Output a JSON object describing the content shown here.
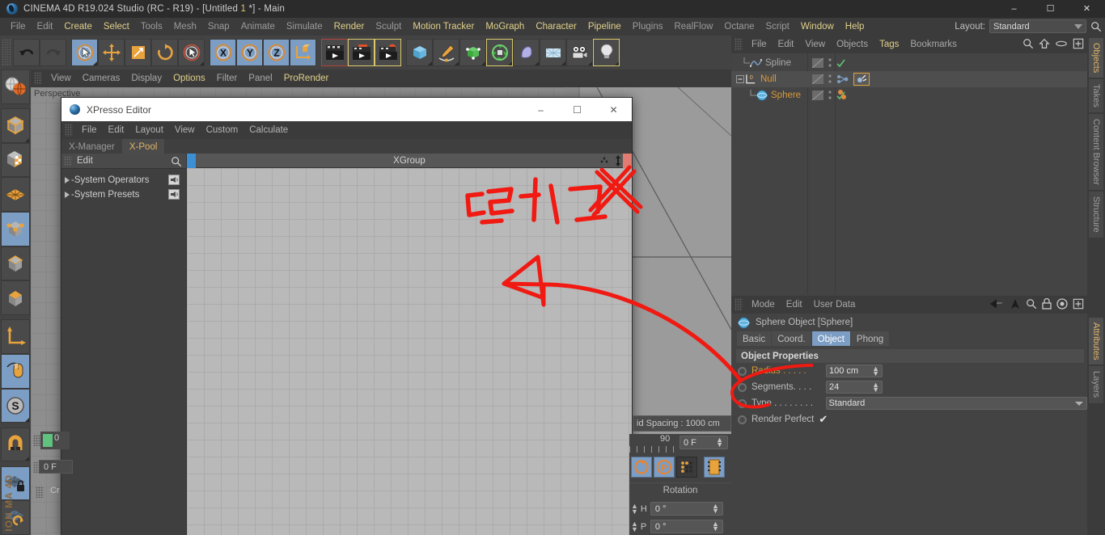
{
  "window": {
    "title_prefix": "CINEMA 4D R19.024 Studio (RC - R19) - [Untitled ",
    "title_num": "1",
    "title_suffix": " *] - Main",
    "minimize": "–",
    "maximize": "☐",
    "close": "✕"
  },
  "menubar": {
    "items": [
      {
        "label": "File",
        "style": "dim"
      },
      {
        "label": "Edit",
        "style": "dim"
      },
      {
        "label": "Create",
        "style": "hl"
      },
      {
        "label": "Select",
        "style": "hl"
      },
      {
        "label": "Tools",
        "style": "dim"
      },
      {
        "label": "Mesh",
        "style": "dim"
      },
      {
        "label": "Snap",
        "style": "dim"
      },
      {
        "label": "Animate",
        "style": "dim"
      },
      {
        "label": "Simulate",
        "style": "dim"
      },
      {
        "label": "Render",
        "style": "hl"
      },
      {
        "label": "Sculpt",
        "style": "dim"
      },
      {
        "label": "Motion Tracker",
        "style": "hl"
      },
      {
        "label": "MoGraph",
        "style": "hl"
      },
      {
        "label": "Character",
        "style": "hl"
      },
      {
        "label": "Pipeline",
        "style": "hl"
      },
      {
        "label": "Plugins",
        "style": "dim"
      },
      {
        "label": "RealFlow",
        "style": "dim"
      },
      {
        "label": "Octane",
        "style": "dim"
      },
      {
        "label": "Script",
        "style": "dim"
      },
      {
        "label": "Window",
        "style": "hl"
      },
      {
        "label": "Help",
        "style": "hl"
      }
    ],
    "layout_label": "Layout:",
    "layout_value": "Standard"
  },
  "viewport": {
    "menus": [
      {
        "label": "View",
        "style": "dim"
      },
      {
        "label": "Cameras",
        "style": "dim"
      },
      {
        "label": "Display",
        "style": "dim"
      },
      {
        "label": "Options",
        "style": "hl"
      },
      {
        "label": "Filter",
        "style": "dim"
      },
      {
        "label": "Panel",
        "style": "dim"
      },
      {
        "label": "ProRender",
        "style": "hl"
      }
    ],
    "label": "Perspective"
  },
  "xpresso": {
    "title": "XPresso Editor",
    "minimize": "–",
    "maximize": "☐",
    "close": "✕",
    "menus": [
      "File",
      "Edit",
      "Layout",
      "View",
      "Custom",
      "Calculate"
    ],
    "tabs": [
      {
        "label": "X-Manager",
        "active": false
      },
      {
        "label": "X-Pool",
        "active": true
      }
    ],
    "pool": {
      "edit_label": "Edit",
      "items": [
        {
          "label": "-System Operators"
        },
        {
          "label": "-System Presets"
        }
      ]
    },
    "graph_title": "XGroup"
  },
  "object_manager": {
    "menus": [
      {
        "label": "File",
        "style": "dim"
      },
      {
        "label": "Edit",
        "style": "dim"
      },
      {
        "label": "View",
        "style": "dim"
      },
      {
        "label": "Objects",
        "style": "dim"
      },
      {
        "label": "Tags",
        "style": "hl"
      },
      {
        "label": "Bookmarks",
        "style": "dim"
      }
    ],
    "rows": [
      {
        "label": "Spline",
        "color": "grey",
        "indent": 14,
        "icon": "spline-icon",
        "check": true
      },
      {
        "label": "Null",
        "color": "orange",
        "indent": 6,
        "icon": "null-icon",
        "check": false
      },
      {
        "label": "Sphere",
        "color": "orange",
        "indent": 26,
        "icon": "sphere-icon",
        "check": true
      }
    ]
  },
  "attribute_manager": {
    "menus": [
      "Mode",
      "Edit",
      "User Data"
    ],
    "object_title": "Sphere Object [Sphere]",
    "tabs": [
      {
        "label": "Basic",
        "active": false
      },
      {
        "label": "Coord.",
        "active": false
      },
      {
        "label": "Object",
        "active": true
      },
      {
        "label": "Phong",
        "active": false
      }
    ],
    "section_title": "Object Properties",
    "properties": [
      {
        "label": "Radius . . . . .",
        "value": "100 cm",
        "type": "spin",
        "highlight": true
      },
      {
        "label": "Segments. . . .",
        "value": "24",
        "type": "spin",
        "highlight": false
      },
      {
        "label": "Type . . . . . . . .",
        "value": "Standard",
        "type": "dropdown",
        "highlight": false
      },
      {
        "label": "Render Perfect",
        "value": "✔",
        "type": "check",
        "highlight": false
      }
    ]
  },
  "vertical_tabs": {
    "top": [
      {
        "label": "Objects",
        "active": true
      },
      {
        "label": "Takes",
        "active": false
      },
      {
        "label": "Content Browser",
        "active": false
      },
      {
        "label": "Structure",
        "active": false
      }
    ],
    "bottom": [
      {
        "label": "Attributes",
        "active": true
      },
      {
        "label": "Layers",
        "active": false
      }
    ]
  },
  "bottom_widgets": {
    "grid_spacing": "id Spacing : 1000 cm",
    "timeline_max": "90",
    "frame_value": "0 F",
    "rotation_label": "Rotation",
    "coords": [
      {
        "axis": "H",
        "value": "0 °"
      },
      {
        "axis": "P",
        "value": "0 °"
      }
    ],
    "left_marker_value": "0",
    "left_frame_value": "0 F",
    "left_cr": "Cr"
  },
  "branding": {
    "vertical": "ION\nMA 4D"
  },
  "annotations": {
    "handwritten_text": "드래그",
    "colors": {
      "ink": "#f01a12"
    }
  },
  "colors": {
    "accent_orange": "#d79a38",
    "accent_blue": "#7d9ec4",
    "panel_bg": "#434343",
    "menu_bg": "#3b3b3b"
  }
}
